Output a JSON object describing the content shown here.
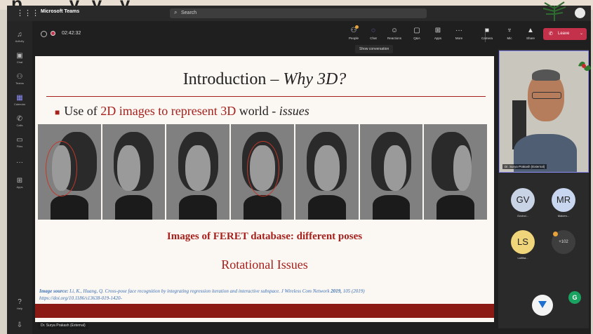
{
  "window": {
    "app_name": "Microsoft Teams",
    "search_placeholder": "Search",
    "accent": "#8b8cf6"
  },
  "rail": [
    {
      "label": "Activity",
      "icon": "bell-icon"
    },
    {
      "label": "Chat",
      "icon": "chat-icon"
    },
    {
      "label": "Teams",
      "icon": "teams-icon"
    },
    {
      "label": "Calendar",
      "icon": "calendar-icon"
    },
    {
      "label": "Calls",
      "icon": "phone-icon"
    },
    {
      "label": "Files",
      "icon": "file-icon"
    },
    {
      "label": "",
      "icon": "more-dots-icon"
    },
    {
      "label": "Apps",
      "icon": "apps-icon"
    },
    {
      "label": "Help",
      "icon": "help-icon"
    },
    {
      "label": "",
      "icon": "download-icon"
    }
  ],
  "meeting": {
    "timer": "02:42:32",
    "controls": [
      {
        "label": "People",
        "icon": "people-icon"
      },
      {
        "label": "Chat",
        "icon": "chat-icon"
      },
      {
        "label": "Reactions",
        "icon": "reactions-icon"
      },
      {
        "label": "Q&A",
        "icon": "qa-icon"
      },
      {
        "label": "Apps",
        "icon": "apps-icon"
      },
      {
        "label": "More",
        "icon": "more-dots-icon"
      },
      {
        "label": "Camera",
        "icon": "camera-icon"
      },
      {
        "label": "Mic",
        "icon": "mic-icon"
      },
      {
        "label": "Share",
        "icon": "share-icon"
      }
    ],
    "leave_label": "Leave",
    "tooltip": "Show conversation"
  },
  "slide": {
    "title_plain": "Introduction – ",
    "title_italic": "Why 3D?",
    "bullet_pre": "Use of ",
    "bullet_red": "2D images to represent 3D",
    "bullet_mid": " world - ",
    "bullet_italic": "issues",
    "caption": "Images of FERET database: different poses",
    "subheading": "Rotational Issues",
    "source_label": "Image source:",
    "source_text": " Li, K., Huang, Q. Cross-pose face recognition by integrating regression iteration and interactive subspace. J Wireless Com Network ",
    "source_year": "2019,",
    "source_tail": " 105 (2019)",
    "source_url": "https://doi.org/10.1186/s13638-019-1420-",
    "colors": {
      "accent_red": "#a6201c",
      "link_blue": "#3a6fb5"
    }
  },
  "presenter_tag": "Dr. Surya Prakash (External)",
  "participants": {
    "video_name": "Dr. Surya Prakash (External)",
    "tiles": [
      {
        "initials": "GV",
        "name": "Govind...",
        "color": "#c8d3e6"
      },
      {
        "initials": "MR",
        "name": "Makem...",
        "color": "#c9d6ef"
      },
      {
        "initials": "LS",
        "name": "Lalitha...",
        "color": "#f0d57a"
      }
    ],
    "overflow": "+102"
  }
}
